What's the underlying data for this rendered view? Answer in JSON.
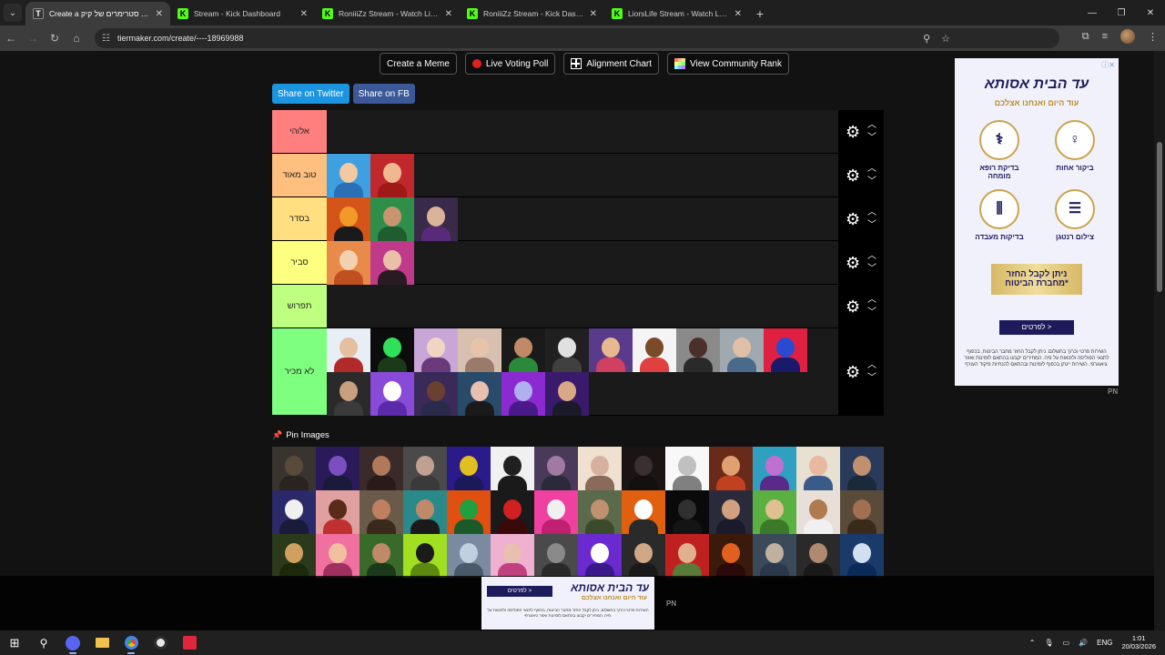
{
  "browser": {
    "tabs": [
      {
        "title": "Create a טירוג סטרימרים של קיק",
        "favicon": "tiermaker",
        "active": true
      },
      {
        "title": "Stream - Kick Dashboard",
        "favicon": "kick",
        "active": false
      },
      {
        "title": "RoniiiZz Stream - Watch Live on",
        "favicon": "kick",
        "active": false
      },
      {
        "title": "RoniiiZz Stream - Kick Dashboa",
        "favicon": "kick",
        "active": false
      },
      {
        "title": "LiorsLife Stream - Watch Live on",
        "favicon": "kick",
        "active": false
      }
    ],
    "url": "tiermaker.com/create/----18969988"
  },
  "toolbar": {
    "create_meme": "Create a Meme",
    "live_voting": "Live Voting Poll",
    "alignment_chart": "Alignment Chart",
    "community_rank": "View Community Rank"
  },
  "share": {
    "twitter": "Share on Twitter",
    "facebook": "Share on FB"
  },
  "tiers": [
    {
      "label": "אלוהי",
      "color": "#ff7f7f",
      "items": []
    },
    {
      "label": "טוב מאוד",
      "color": "#ffbf7f",
      "items": [
        {
          "bg": "#3ea0e0",
          "skin": "#f2c9a0",
          "shirt": "#2b6fb6"
        },
        {
          "bg": "#c0282c",
          "skin": "#f0b890",
          "shirt": "#a01818"
        }
      ]
    },
    {
      "label": "בסדר",
      "color": "#ffdf7f",
      "items": [
        {
          "bg": "#d4541a",
          "skin": "#f29a28",
          "shirt": "#1a1a1a"
        },
        {
          "bg": "#2f8f4a",
          "skin": "#c8956e",
          "shirt": "#1f5c30"
        },
        {
          "bg": "#3a2a4a",
          "skin": "#d9b49a",
          "shirt": "#5a2a7a"
        }
      ]
    },
    {
      "label": "סביר",
      "color": "#ffff7f",
      "items": [
        {
          "bg": "#e88a4a",
          "skin": "#f3d0b0",
          "shirt": "#c05020"
        },
        {
          "bg": "#c03a8a",
          "skin": "#e9c0a8",
          "shirt": "#2a1a22"
        }
      ]
    },
    {
      "label": "תפרוש",
      "color": "#bfff7f",
      "items": []
    },
    {
      "label": "לא מכיר",
      "color": "#7fff7f",
      "items": [
        {
          "bg": "#e8eef6",
          "skin": "#e4bfa0",
          "shirt": "#b02a2a"
        },
        {
          "bg": "#0c0c0c",
          "skin": "#2ee05a",
          "shirt": "#1a3a1a"
        },
        {
          "bg": "#c8a6d8",
          "skin": "#f0d4c4",
          "shirt": "#6a3a7a"
        },
        {
          "bg": "#d8c0b0",
          "skin": "#e6c4aa",
          "shirt": "#9a7a6a"
        },
        {
          "bg": "#1a1a1a",
          "skin": "#c08a66",
          "shirt": "#2a8a3a"
        },
        {
          "bg": "#202020",
          "skin": "#e0e0e0",
          "shirt": "#404040"
        },
        {
          "bg": "#5a3a8a",
          "skin": "#e8b890",
          "shirt": "#d04060"
        },
        {
          "bg": "#f4f4f4",
          "skin": "#7a4a2a",
          "shirt": "#e04040"
        },
        {
          "bg": "#8a8a8a",
          "skin": "#4a3028",
          "shirt": "#2a2a2a"
        },
        {
          "bg": "#a0a8b0",
          "skin": "#e2c0a8",
          "shirt": "#4a6a8a"
        },
        {
          "bg": "#e02040",
          "skin": "#2a4ad0",
          "shirt": "#1a1a6a"
        },
        {
          "bg": "#2a2a2a",
          "skin": "#c8a080",
          "shirt": "#3a3a3a"
        },
        {
          "bg": "#8a4ad8",
          "skin": "#ffffff",
          "shirt": "#5a2aa8"
        },
        {
          "bg": "#3a2a5a",
          "skin": "#6a4030",
          "shirt": "#2a2a4a"
        },
        {
          "bg": "#2a4a6a",
          "skin": "#e8c0b0",
          "shirt": "#1a1a1a"
        },
        {
          "bg": "#8a2ad0",
          "skin": "#b0b0f0",
          "shirt": "#4a1a8a"
        },
        {
          "bg": "#3a1a6a",
          "skin": "#d8a888",
          "shirt": "#1a1a2a"
        }
      ]
    }
  ],
  "pin": {
    "title": "Pin Images",
    "items": [
      {
        "bg": "#3a3430",
        "skin": "#5a4a3a",
        "shirt": "#2a2420"
      },
      {
        "bg": "#2a1a5a",
        "skin": "#7a50c0",
        "shirt": "#1a1a3a"
      },
      {
        "bg": "#3a2a2a",
        "skin": "#b07a5a",
        "shirt": "#2a1a1a"
      },
      {
        "bg": "#4a4a4a",
        "skin": "#c0a090",
        "shirt": "#3a3a3a"
      },
      {
        "bg": "#2a1a8a",
        "skin": "#e0c020",
        "shirt": "#1a1a5a"
      },
      {
        "bg": "#f0f0f0",
        "skin": "#202020",
        "shirt": "#1a1a1a"
      },
      {
        "bg": "#4a3a5a",
        "skin": "#a07aa0",
        "shirt": "#2a2a3a"
      },
      {
        "bg": "#f0e0d0",
        "skin": "#d8b0a0",
        "shirt": "#8a6a5a"
      },
      {
        "bg": "#1a1414",
        "skin": "#3a3030",
        "shirt": "#141010"
      },
      {
        "bg": "#f8f8f8",
        "skin": "#c0c0c0",
        "shirt": "#808080"
      },
      {
        "bg": "#6a2a1a",
        "skin": "#e0a070",
        "shirt": "#c04020"
      },
      {
        "bg": "#30a0c0",
        "skin": "#c070d0",
        "shirt": "#5a2a8a"
      },
      {
        "bg": "#e8e0d0",
        "skin": "#e8b8a0",
        "shirt": "#3a5a8a"
      },
      {
        "bg": "#2a3a5a",
        "skin": "#c09070",
        "shirt": "#1a2a3a"
      },
      {
        "bg": "#2a2a6a",
        "skin": "#f0f0f0",
        "shirt": "#1a1a3a"
      },
      {
        "bg": "#e0a0a0",
        "skin": "#5a2a1a",
        "shirt": "#c03030"
      },
      {
        "bg": "#6a5a4a",
        "skin": "#c08060",
        "shirt": "#3a2a1a"
      },
      {
        "bg": "#2a8a8a",
        "skin": "#c08a6a",
        "shirt": "#1a1a1a"
      },
      {
        "bg": "#e05010",
        "skin": "#20a040",
        "shirt": "#1a5a2a"
      },
      {
        "bg": "#1a1a1a",
        "skin": "#d02020",
        "shirt": "#3a0a0a"
      },
      {
        "bg": "#f040a0",
        "skin": "#f0f0f0",
        "shirt": "#c02070"
      },
      {
        "bg": "#5a6a4a",
        "skin": "#c09070",
        "shirt": "#3a4a2a"
      },
      {
        "bg": "#e06010",
        "skin": "#ffffff",
        "shirt": "#2a2a2a"
      },
      {
        "bg": "#0a0a0a",
        "skin": "#303030",
        "shirt": "#141414"
      },
      {
        "bg": "#2a2a3a",
        "skin": "#d0a080",
        "shirt": "#1a1a2a"
      },
      {
        "bg": "#5ab040",
        "skin": "#e0c090",
        "shirt": "#3a7a2a"
      },
      {
        "bg": "#e8e0d8",
        "skin": "#b07a50",
        "shirt": "#f0f0f0"
      },
      {
        "bg": "#5a4a3a",
        "skin": "#a07050",
        "shirt": "#3a2a1a"
      },
      {
        "bg": "#2a3a1a",
        "skin": "#d0a060",
        "shirt": "#1a2a0a"
      },
      {
        "bg": "#f070a0",
        "skin": "#f0c0a0",
        "shirt": "#a03060"
      },
      {
        "bg": "#3a6a2a",
        "skin": "#c08a6a",
        "shirt": "#1a3a1a"
      },
      {
        "bg": "#a0e020",
        "skin": "#1a1a1a",
        "shirt": "#5a8a10"
      },
      {
        "bg": "#7a8aa0",
        "skin": "#c0d0e0",
        "shirt": "#4a5a6a"
      },
      {
        "bg": "#f0b0d0",
        "skin": "#e8c0b0",
        "shirt": "#c04080"
      },
      {
        "bg": "#4a4a4a",
        "skin": "#8a8a8a",
        "shirt": "#2a2a2a"
      },
      {
        "bg": "#6a2ad0",
        "skin": "#ffffff",
        "shirt": "#3a1a8a"
      },
      {
        "bg": "#2a2a2a",
        "skin": "#d0a888",
        "shirt": "#1a1a1a"
      },
      {
        "bg": "#c02020",
        "skin": "#e0b090",
        "shirt": "#5a7a3a"
      },
      {
        "bg": "#3a1a0a",
        "skin": "#e06020",
        "shirt": "#2a0a0a"
      },
      {
        "bg": "#3a4a5a",
        "skin": "#c0b0a0",
        "shirt": "#2a3a4a"
      },
      {
        "bg": "#2a2a2a",
        "skin": "#b08a70",
        "shirt": "#1a1a1a"
      },
      {
        "bg": "#1a3a6a",
        "skin": "#d0e0f0",
        "shirt": "#0a2a5a"
      }
    ]
  },
  "ad_side": {
    "brand": "עד הבית",
    "logo": "אסותא",
    "tagline": "עוד היום ואנחנו אצלכם",
    "services": [
      "ביקור אחות",
      "בדיקת רופא מומחה",
      "צילום רנטגן",
      "בדיקות מעבדה"
    ],
    "highlight": "ניתן לקבל החזר מחברת הביטוח*",
    "cta": "לפרטים >",
    "fine": "השירות פרטי וכרוך בתשלום. ניתן לקבל החזר מחבר הביטוח, בכפוף לתנאי הפוליסה ולזכאות על פיה. המחירים יקבעו בהתאם לזמינות ואזור גיאוגרפי. השירות יינתן בכפוף לזמינות ובהתאם להנחיות פיקוד העורף.",
    "pn": "PN"
  },
  "ad_bottom": {
    "logo": "אסותא",
    "brand": "עד הבית",
    "tagline": "עוד היום ואנחנו אצלכם",
    "cta": "לפרטים >",
    "fine": "השירות פרטי וכרוך בתשלום. ניתן לקבל החזר מחבר הביטוח, בכפוף לתנאי הפוליסה ולזכאות על פיה. המחירים יקבעו בהתאם לזמינות ואזור גיאוגרפי.",
    "pn": "PN"
  },
  "taskbar": {
    "lang": "ENG",
    "time": "1:01",
    "date": "20/03/2026"
  }
}
